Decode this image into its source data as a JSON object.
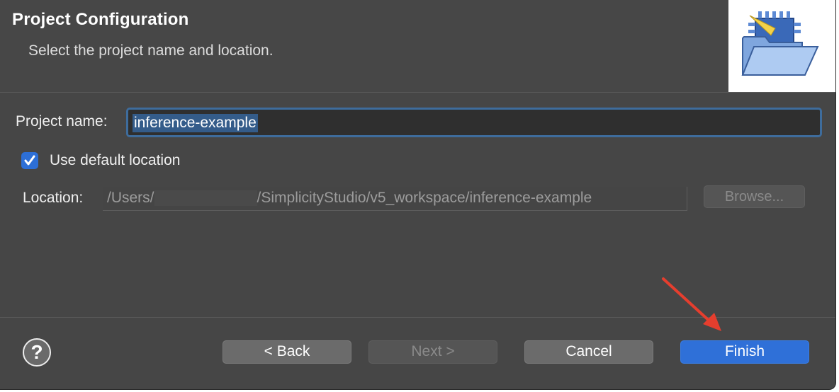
{
  "header": {
    "title": "Project Configuration",
    "subtitle": "Select the project name and location."
  },
  "banner": {
    "icon": "wizard-folder-icon"
  },
  "project_name": {
    "label": "Project name:",
    "value": "inference-example"
  },
  "default_location": {
    "label": "Use default location",
    "checked": true
  },
  "location": {
    "label": "Location:",
    "value_prefix": "/Users/",
    "value_suffix": "/SimplicityStudio/v5_workspace/inference-example",
    "browse_label": "Browse..."
  },
  "footer": {
    "help_icon": "help-icon",
    "help_label": "?",
    "back_label": "< Back",
    "next_label": "Next >",
    "cancel_label": "Cancel",
    "finish_label": "Finish"
  },
  "colors": {
    "accent": "#2f70d8",
    "annotation_arrow": "#e53e2e"
  }
}
